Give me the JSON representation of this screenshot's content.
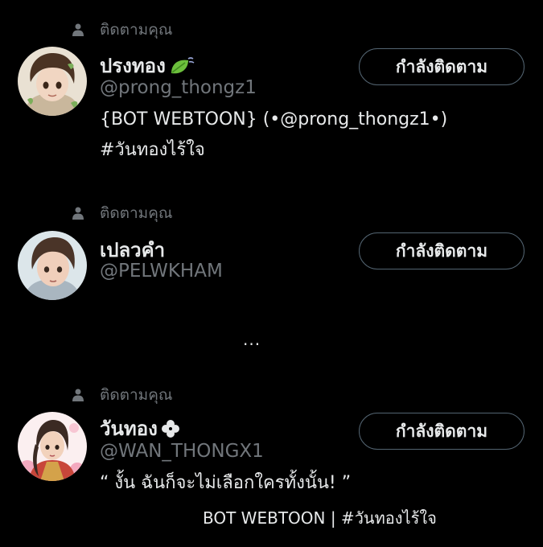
{
  "followers": [
    {
      "follows_you": "ติดตามคุณ",
      "name": "ปรงทอง",
      "name_emoji": "leaf-icon",
      "handle": "@prong_thongz1",
      "bio_line1": "{BOT WEBTOON} (•@prong_thongz1•)",
      "bio_line2": "#วันทองไร้ใจ",
      "button": "กำลังติดตาม"
    },
    {
      "follows_you": "ติดตามคุณ",
      "name": "เปลวคำ",
      "handle": "@PELWKHAM",
      "button": "กำลังติดตาม"
    },
    {
      "follows_you": "ติดตามคุณ",
      "name": "วันทอง",
      "name_emoji": "clover-icon",
      "handle": "@WAN_THONGX1",
      "bio_line1": "“ งั้น ฉันก็จะไม่เลือกใครทั้งนั้น! ”",
      "bio_line2": "BOT WEBTOON | #วันทองไร้ใจ",
      "button": "กำลังติดตาม"
    }
  ],
  "ellipsis": "...",
  "colors": {
    "background": "#000000",
    "primary_text": "#e7e9ea",
    "secondary_text": "#71767b",
    "button_border": "#536471"
  }
}
